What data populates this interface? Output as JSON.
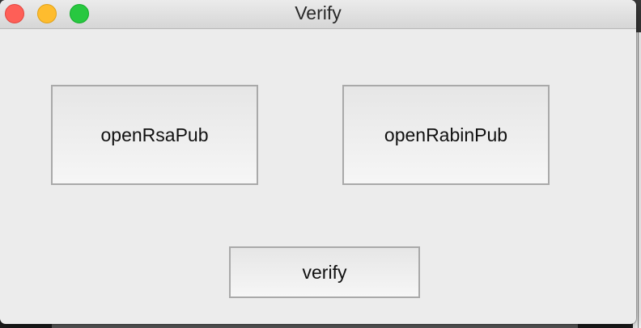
{
  "window": {
    "title": "Verify"
  },
  "buttons": {
    "open_rsa_pub": "openRsaPub",
    "open_rabin_pub": "openRabinPub",
    "verify": "verify"
  },
  "colors": {
    "close": "#fe5f57",
    "minimize": "#febc2e",
    "zoom": "#28c840",
    "window_background": "#ececec"
  }
}
